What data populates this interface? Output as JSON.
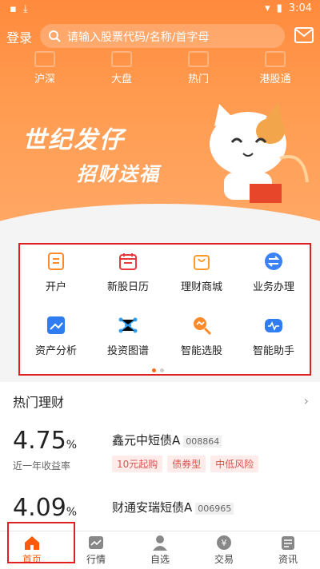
{
  "status_bar": {
    "time": "3:04"
  },
  "header": {
    "login_label": "登录",
    "search_placeholder": "请输入股票代码/名称/首字母"
  },
  "quick_nav": [
    {
      "label": "沪深"
    },
    {
      "label": "大盘"
    },
    {
      "label": "热门"
    },
    {
      "label": "港股通"
    }
  ],
  "banner": {
    "line1": "世纪发仔",
    "line2": "招财送福"
  },
  "services": [
    {
      "label": "开户",
      "icon": "account-open-icon",
      "color": "#ff8a2a"
    },
    {
      "label": "新股日历",
      "icon": "calendar-icon",
      "color": "#e83a3a"
    },
    {
      "label": "理财商城",
      "icon": "shopping-bag-icon",
      "color": "#ff9a2a"
    },
    {
      "label": "业务办理",
      "icon": "exchange-icon",
      "color": "#3b82f6"
    },
    {
      "label": "资产分析",
      "icon": "chart-trend-icon",
      "color": "#2f7df0"
    },
    {
      "label": "投资图谱",
      "icon": "network-icon",
      "color": "#2f9df0"
    },
    {
      "label": "智能选股",
      "icon": "magnifier-icon",
      "color": "#ff8a2a"
    },
    {
      "label": "智能助手",
      "icon": "assistant-icon",
      "color": "#2f7df0"
    }
  ],
  "hot_finance": {
    "title": "热门理财",
    "funds": [
      {
        "rate": "4.75",
        "unit": "%",
        "rate_label": "近一年收益率",
        "name": "鑫元中短债A",
        "code": "008864",
        "tags": [
          "10元起购",
          "债券型",
          "中低风险"
        ]
      },
      {
        "rate": "4.09",
        "unit": "%",
        "name": "财通安瑞短债A",
        "code": "006965"
      }
    ]
  },
  "tabbar": [
    {
      "label": "首页",
      "active": true
    },
    {
      "label": "行情",
      "active": false
    },
    {
      "label": "自选",
      "active": false
    },
    {
      "label": "交易",
      "active": false
    },
    {
      "label": "资讯",
      "active": false
    }
  ],
  "colors": {
    "accent": "#ff6a1a",
    "highlight_box": "#e02020"
  }
}
